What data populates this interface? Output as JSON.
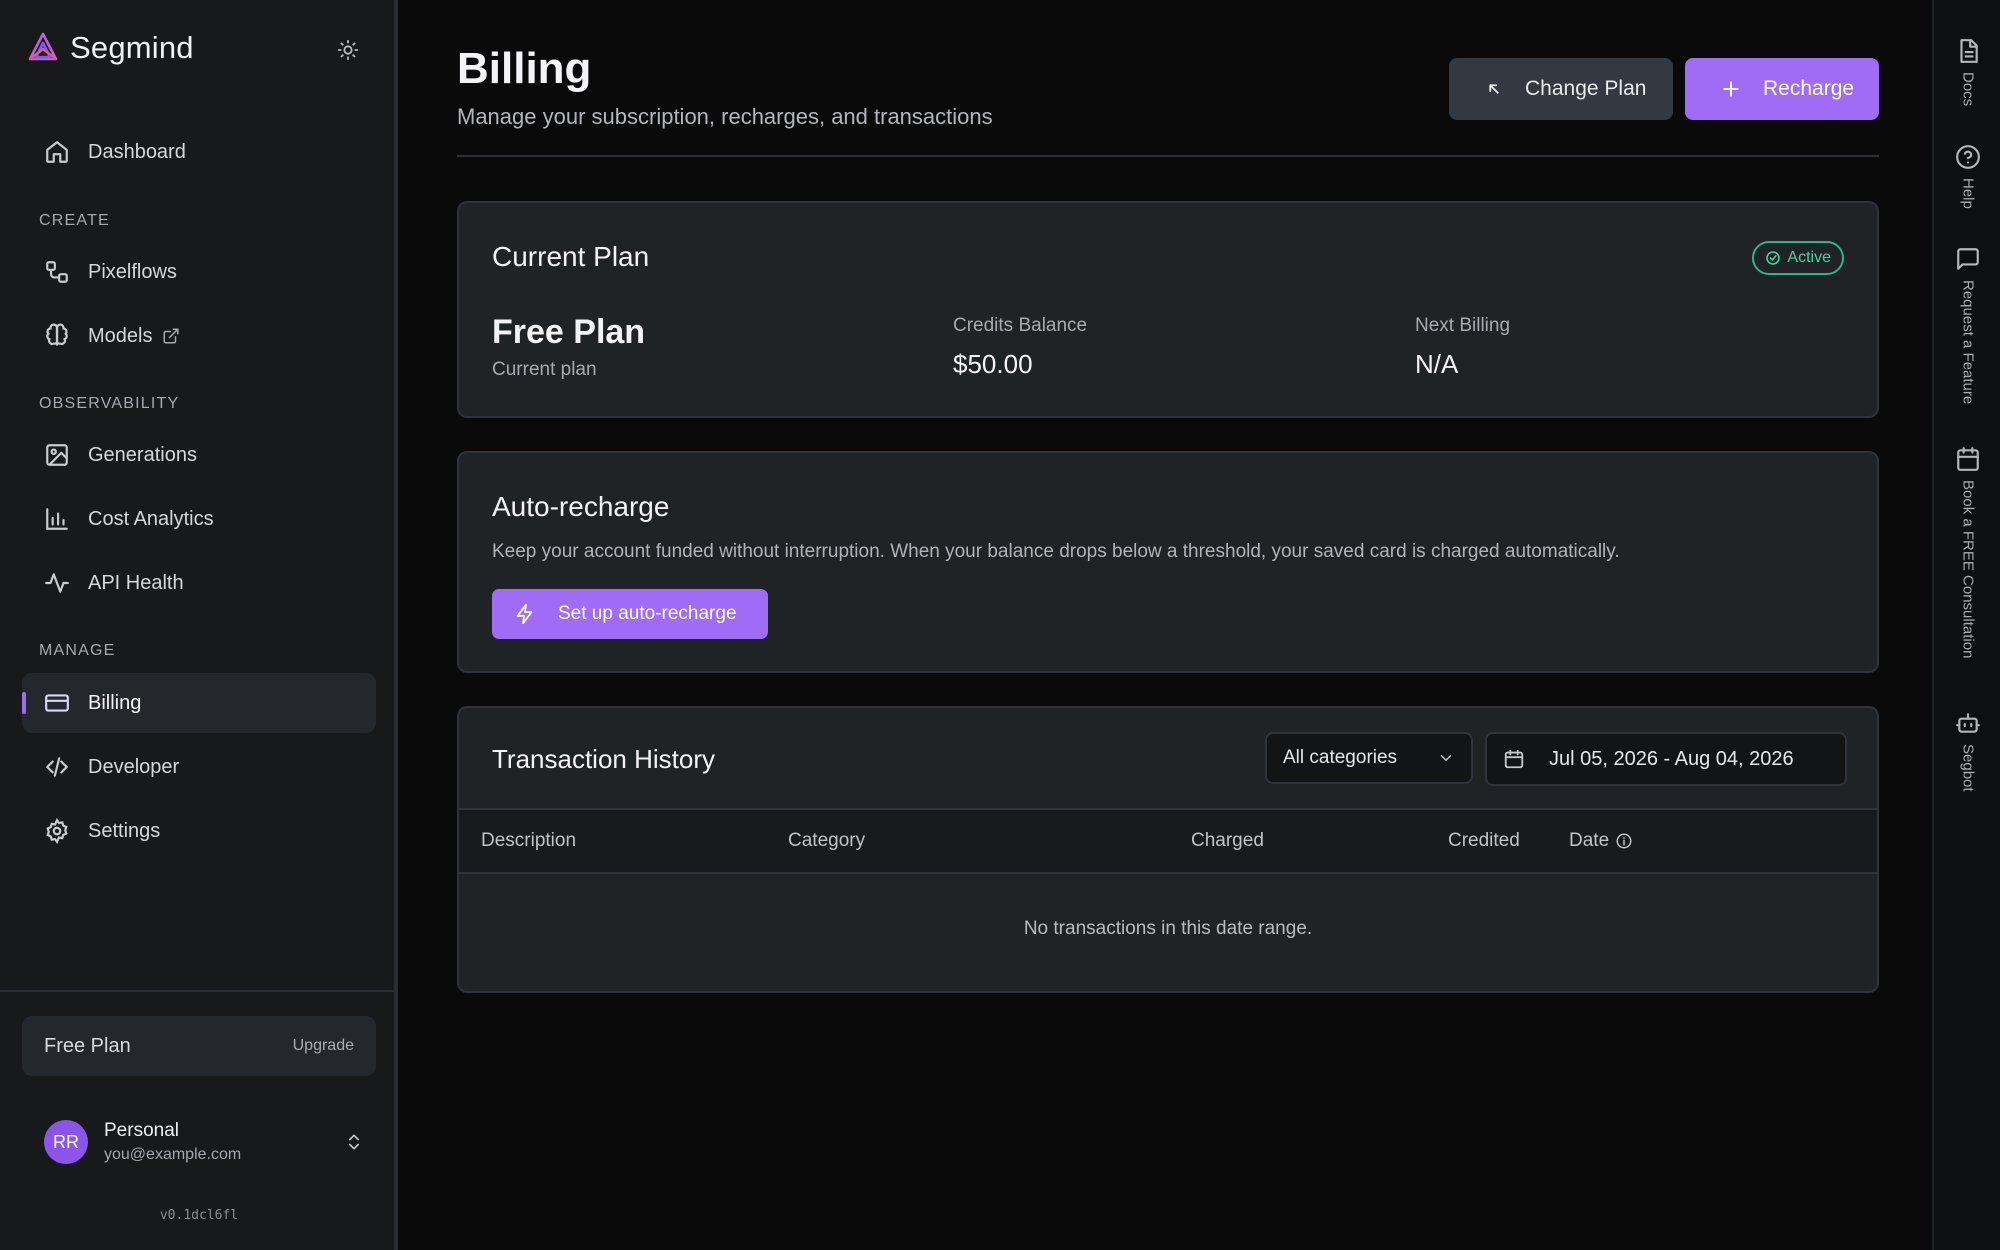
{
  "brand": {
    "name": "Segmind"
  },
  "sidebar": {
    "nav_top": [
      {
        "label": "Dashboard",
        "icon": "home-icon"
      }
    ],
    "sections": [
      {
        "title": "CREATE",
        "items": [
          {
            "label": "Pixelflows",
            "icon": "workflow-icon"
          },
          {
            "label": "Models",
            "icon": "brain-icon",
            "external": true
          }
        ]
      },
      {
        "title": "OBSERVABILITY",
        "items": [
          {
            "label": "Generations",
            "icon": "image-icon"
          },
          {
            "label": "Cost Analytics",
            "icon": "bar-chart-icon"
          },
          {
            "label": "API Health",
            "icon": "activity-icon"
          }
        ]
      },
      {
        "title": "MANAGE",
        "items": [
          {
            "label": "Billing",
            "icon": "credit-card-icon",
            "active": true
          },
          {
            "label": "Developer",
            "icon": "code-icon"
          },
          {
            "label": "Settings",
            "icon": "gear-icon"
          }
        ]
      }
    ],
    "plan": {
      "name": "Free Plan",
      "upgrade_label": "Upgrade"
    },
    "user": {
      "initials": "RR",
      "name": "Personal",
      "email": "you@example.com"
    },
    "version": "v0.1dcl6fl"
  },
  "header": {
    "title": "Billing",
    "subtitle": "Manage your subscription, recharges, and transactions",
    "change_plan_label": "Change Plan",
    "recharge_label": "Recharge"
  },
  "current_plan": {
    "title": "Current Plan",
    "status": "Active",
    "plan_name": "Free Plan",
    "plan_sub": "Current plan",
    "credits_label": "Credits Balance",
    "credits_value": "$50.00",
    "next_billing_label": "Next Billing",
    "next_billing_value": "N/A"
  },
  "auto_recharge": {
    "title": "Auto-recharge",
    "description": "Keep your account funded without interruption. When your balance drops below a threshold, your saved card is charged automatically.",
    "button_label": "Set up auto-recharge"
  },
  "transactions": {
    "title": "Transaction History",
    "category_filter": "All categories",
    "date_range": "Jul 05, 2026 - Aug 04, 2026",
    "columns": [
      "Description",
      "Category",
      "Charged",
      "Credited",
      "Date"
    ],
    "empty_message": "No transactions in this date range."
  },
  "right_rail": [
    {
      "label": "Docs",
      "icon": "doc-icon"
    },
    {
      "label": "Help",
      "icon": "help-circle-icon"
    },
    {
      "label": "Request a Feature",
      "icon": "message-square-icon"
    },
    {
      "label": "Book a FREE Consultation",
      "icon": "calendar-icon"
    },
    {
      "label": "Segbot",
      "icon": "bot-icon"
    }
  ],
  "colors": {
    "accent": "#a06cf5",
    "active_green": "#48d2a2",
    "bg": "#0a0a0b",
    "card": "#202325"
  }
}
